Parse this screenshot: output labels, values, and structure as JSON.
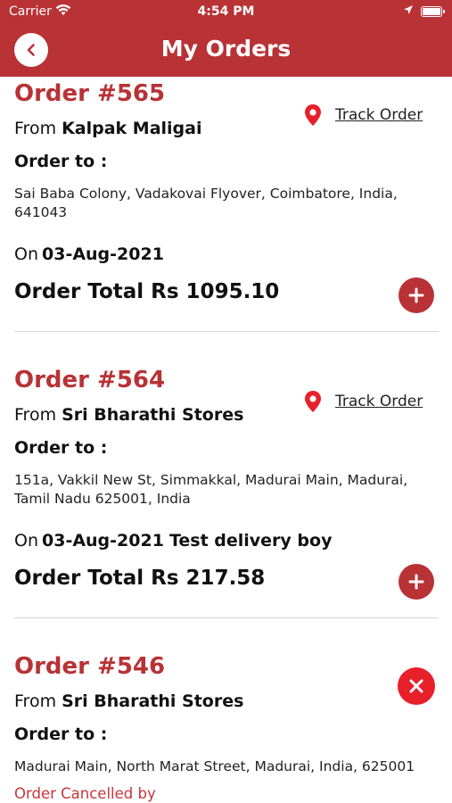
{
  "status_bar": {
    "carrier": "Carrier",
    "time": "4:54 PM"
  },
  "header": {
    "title": "My Orders"
  },
  "orders": [
    {
      "number": "Order #565",
      "from_label": "From",
      "store": "Kalpak Maligai",
      "order_to_label": "Order to :",
      "address": "Sai Baba Colony, Vadakovai Flyover, Coimbatore, India, 641043",
      "on_label": "On",
      "date": "03-Aug-2021",
      "total": "Order Total Rs 1095.10",
      "track_label": "Track Order"
    },
    {
      "number": "Order #564",
      "from_label": "From",
      "store": "Sri Bharathi Stores",
      "order_to_label": "Order to :",
      "address": "151a, Vakkil New St, Simmakkal, Madurai Main, Madurai, Tamil Nadu 625001, India",
      "on_label": "On",
      "date": "03-Aug-2021",
      "delivery_boy": "Test delivery boy",
      "total": "Order Total Rs 217.58",
      "track_label": "Track Order"
    },
    {
      "number": "Order #546",
      "from_label": "From",
      "store": "Sri Bharathi Stores",
      "order_to_label": "Order to :",
      "address": "Madurai Main, North Marat Street, Madurai, India, 625001",
      "status": "Order Cancelled by"
    }
  ],
  "colors": {
    "brand": "#b83236",
    "cancel": "#e8202a"
  },
  "icons": {
    "back": "chevron-left-icon",
    "track": "map-pin-icon",
    "expand": "plus-icon",
    "cancel": "close-icon"
  }
}
